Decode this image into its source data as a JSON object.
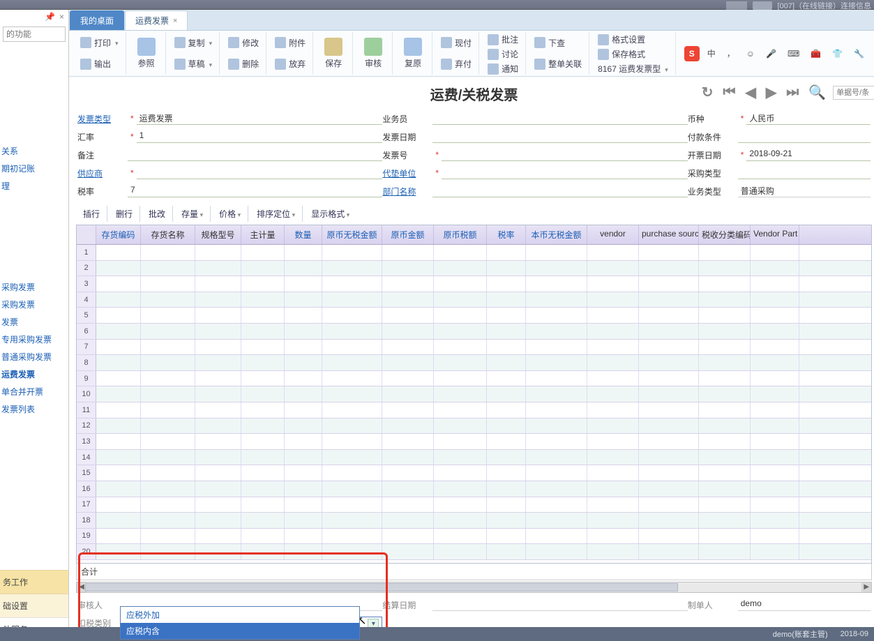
{
  "topbar": {
    "breadcrumb": "[007]（在线链接）连接信息"
  },
  "sidebar": {
    "search_placeholder": "的功能",
    "icons": {
      "pin": "📌",
      "close": "×"
    },
    "links": [
      "关系",
      "期初记账",
      "理",
      "",
      "",
      "",
      "",
      "",
      "采购发票",
      "采购发票",
      "发票",
      "专用采购发票",
      "普通采购发票",
      "运费发票",
      "单合并开票",
      "发票列表"
    ],
    "bottom": [
      "务工作",
      "础设置",
      "处服务"
    ]
  },
  "tabs": {
    "home": "我的桌面",
    "active": "运费发票",
    "close_glyph": "×"
  },
  "ribbon": {
    "print": "打印",
    "output": "输出",
    "ref": "参照",
    "copy": "复制",
    "draft": "草稿",
    "edit": "修改",
    "delete": "删除",
    "attach": "附件",
    "discard": "放弃",
    "save": "保存",
    "audit": "审核",
    "copyback": "复原",
    "cash": "现付",
    "discard2": "弃付",
    "batch": "批注",
    "discuss": "讨论",
    "notify": "通知",
    "check": "下查",
    "link": "整单关联",
    "fmt": "格式设置",
    "savefmt": "保存格式",
    "project": "8167 运费发票型"
  },
  "ime": {
    "letter": "S",
    "zhong": "中",
    "icons": [
      "，",
      "☺",
      "🎤",
      "⌨",
      "🧰",
      "👕",
      "🔧"
    ]
  },
  "page_title": "运费/关税发票",
  "nav": {
    "search_placeholder": "单据号/条"
  },
  "form": {
    "col1": {
      "invoice_type_label": "发票类型",
      "invoice_type_val": "运费发票",
      "rate_label": "汇率",
      "rate_val": "1",
      "remark_label": "备注",
      "remark_val": "",
      "supplier_label": "供应商",
      "supplier_val": "",
      "taxrate_label": "税率",
      "taxrate_val": "7"
    },
    "col2": {
      "salesman_label": "业务员",
      "salesman_val": "",
      "invdate_label": "发票日期",
      "invdate_val": "",
      "invno_label": "发票号",
      "invno_val": "",
      "agent_label": "代垫单位",
      "agent_val": "",
      "dept_label": "部门名称",
      "dept_val": ""
    },
    "col3": {
      "currency_label": "币种",
      "currency_val": "人民币",
      "payterm_label": "付款条件",
      "payterm_val": "",
      "opendate_label": "开票日期",
      "opendate_val": "2018-09-21",
      "purtype_label": "采购类型",
      "purtype_val": "",
      "biztype_label": "业务类型",
      "biztype_val": "普通采购"
    }
  },
  "grid_toolbar": {
    "insert": "插行",
    "delrow": "删行",
    "batchmod": "批改",
    "stock": "存量",
    "price": "价格",
    "sort": "排序定位",
    "display": "显示格式"
  },
  "grid": {
    "headers": [
      "",
      "存货编码",
      "存货名称",
      "规格型号",
      "主计量",
      "数量",
      "原币无税金额",
      "原币金额",
      "原币税额",
      "税率",
      "本币无税金额",
      "vendor",
      "purchase source",
      "税收分类编码",
      "Vendor Part"
    ],
    "row_count": 20
  },
  "total_label": "合计",
  "footer": {
    "auditor_label": "审核人",
    "auditor_val": "",
    "calcdate_label": "结算日期",
    "calcdate_val": "",
    "maker_label": "制单人",
    "maker_val": "demo",
    "taxclass_label": "扣税类别",
    "taxclass_selected": "应税内含",
    "taxclass_options": [
      "应税外加",
      "应税内含"
    ]
  },
  "status": {
    "user": "demo(账套主管)",
    "date": "2018-09"
  }
}
